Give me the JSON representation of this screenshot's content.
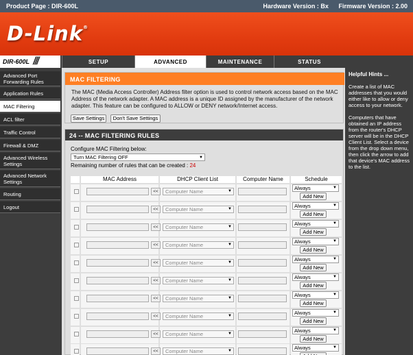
{
  "topbar": {
    "product": "Product Page : DIR-600L",
    "hardware": "Hardware Version : Bx",
    "firmware": "Firmware Version : 2.00"
  },
  "logo": {
    "text": "D-Link",
    "mark": "®"
  },
  "model": "DIR-600L",
  "tabs": [
    {
      "label": "SETUP"
    },
    {
      "label": "ADVANCED"
    },
    {
      "label": "MAINTENANCE"
    },
    {
      "label": "STATUS"
    }
  ],
  "sidebar": {
    "items": [
      {
        "label": "Advanced Port Forwarding Rules"
      },
      {
        "label": "Application Rules"
      },
      {
        "label": "MAC Filtering"
      },
      {
        "label": "ACL filter"
      },
      {
        "label": "Traffic Control"
      },
      {
        "label": "Firewall & DMZ"
      },
      {
        "label": "Advanced Wireless Settings"
      },
      {
        "label": "Advanced Network Settings"
      },
      {
        "label": "Routing"
      },
      {
        "label": "Logout"
      }
    ]
  },
  "mac_filtering": {
    "title": "MAC FILTERING",
    "description": "The MAC (Media Access Controller) Address filter option is used to control network access based on the MAC Address of the network adapter. A MAC address is a unique ID assigned by the manufacturer of the network adapter. This feature can be configured to ALLOW or DENY network/Internet access.",
    "save_label": "Save Settings",
    "dont_save_label": "Don't Save Settings"
  },
  "rules": {
    "title": "24 -- MAC FILTERING RULES",
    "configure_label": "Configure MAC Filtering below:",
    "mode_value": "Turn MAC Filtering OFF",
    "remaining_label": "Remaining number of rules that can be created :",
    "remaining_count": "24",
    "columns": {
      "mac": "MAC Address",
      "dhcp": "DHCP Client List",
      "computer": "Computer Name",
      "schedule": "Schedule"
    },
    "copy_label": "<<",
    "dhcp_placeholder": "Computer Name",
    "schedule_value": "Always",
    "add_new_label": "Add New",
    "colors": {
      "header": "#ff7f24",
      "count": "#cc0000"
    }
  },
  "hints": {
    "title": "Helpful Hints ...",
    "p1": "Create a list of MAC addresses that you would either like to allow or deny access to your network.",
    "p2": "Computers that have obtained an IP address from the router's DHCP server will be in the DHCP Client List. Select a device from the drop down menu, then click the arrow to add that device's MAC address to the list."
  },
  "icons": {
    "dropdown": "chevron-down-icon"
  }
}
